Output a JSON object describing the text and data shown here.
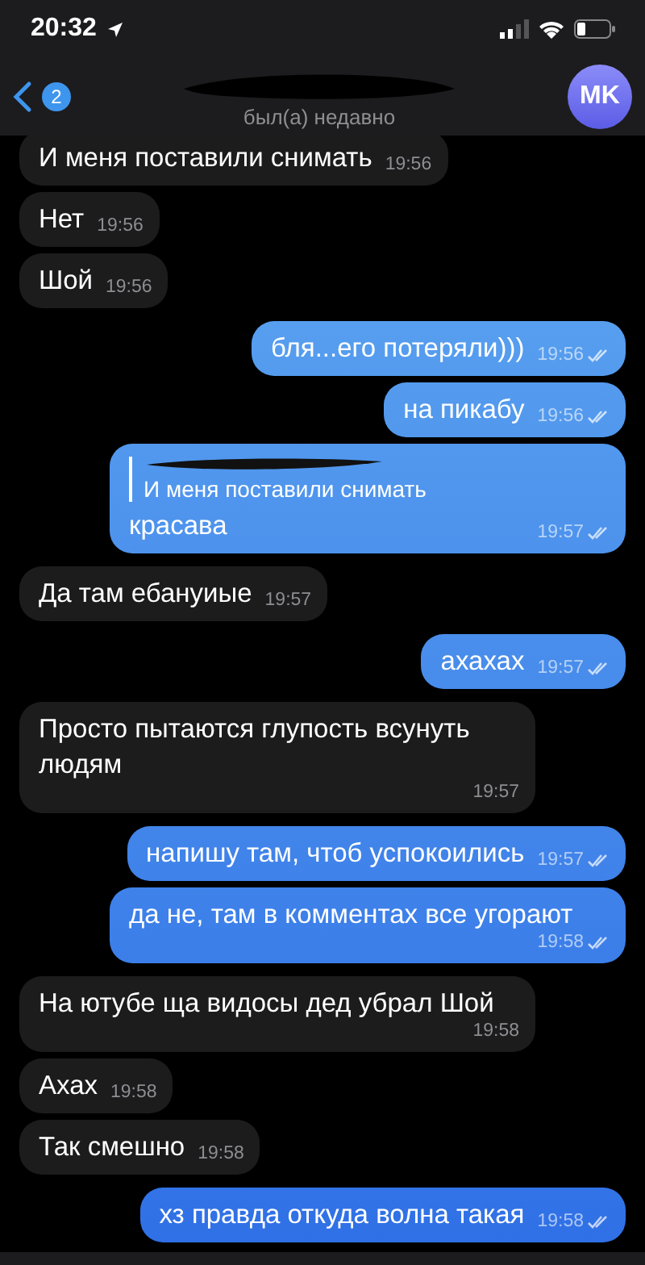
{
  "status_bar": {
    "time": "20:32"
  },
  "header": {
    "back_badge": "2",
    "subtitle": "был(а) недавно",
    "avatar": "MK"
  },
  "messages": [
    {
      "kind": "incoming",
      "text": "И меня поставили снимать",
      "time": "19:56"
    },
    {
      "kind": "incoming",
      "text": "Нет",
      "time": "19:56"
    },
    {
      "kind": "incoming",
      "text": "Шой",
      "time": "19:56"
    },
    {
      "kind": "outgoing",
      "text": "бля...его потеряли)))",
      "time": "19:56",
      "read": true
    },
    {
      "kind": "outgoing",
      "text": "на пикабу",
      "time": "19:56",
      "read": true
    },
    {
      "kind": "outgoing",
      "text": "красава",
      "time": "19:57",
      "read": true,
      "reply": {
        "text": "И меня поставили снимать"
      }
    },
    {
      "kind": "incoming",
      "text": "Да там ебануиые",
      "time": "19:57"
    },
    {
      "kind": "outgoing",
      "text": "ахахах",
      "time": "19:57",
      "read": true
    },
    {
      "kind": "incoming",
      "text": "Просто пытаются глупость всунуть людям",
      "time": "19:57"
    },
    {
      "kind": "outgoing",
      "text": "напишу там, чтоб успокоились",
      "time": "19:57",
      "read": true
    },
    {
      "kind": "outgoing",
      "text": "да не, там в комментах все угорают",
      "time": "19:58",
      "read": true
    },
    {
      "kind": "incoming",
      "text": "На ютубе ща видосы дед убрал Шой",
      "time": "19:58"
    },
    {
      "kind": "incoming",
      "text": "Ахах",
      "time": "19:58"
    },
    {
      "kind": "incoming",
      "text": "Так смешно",
      "time": "19:58"
    },
    {
      "kind": "outgoing",
      "text": "хз правда откуда волна такая",
      "time": "19:58",
      "read": true
    }
  ]
}
